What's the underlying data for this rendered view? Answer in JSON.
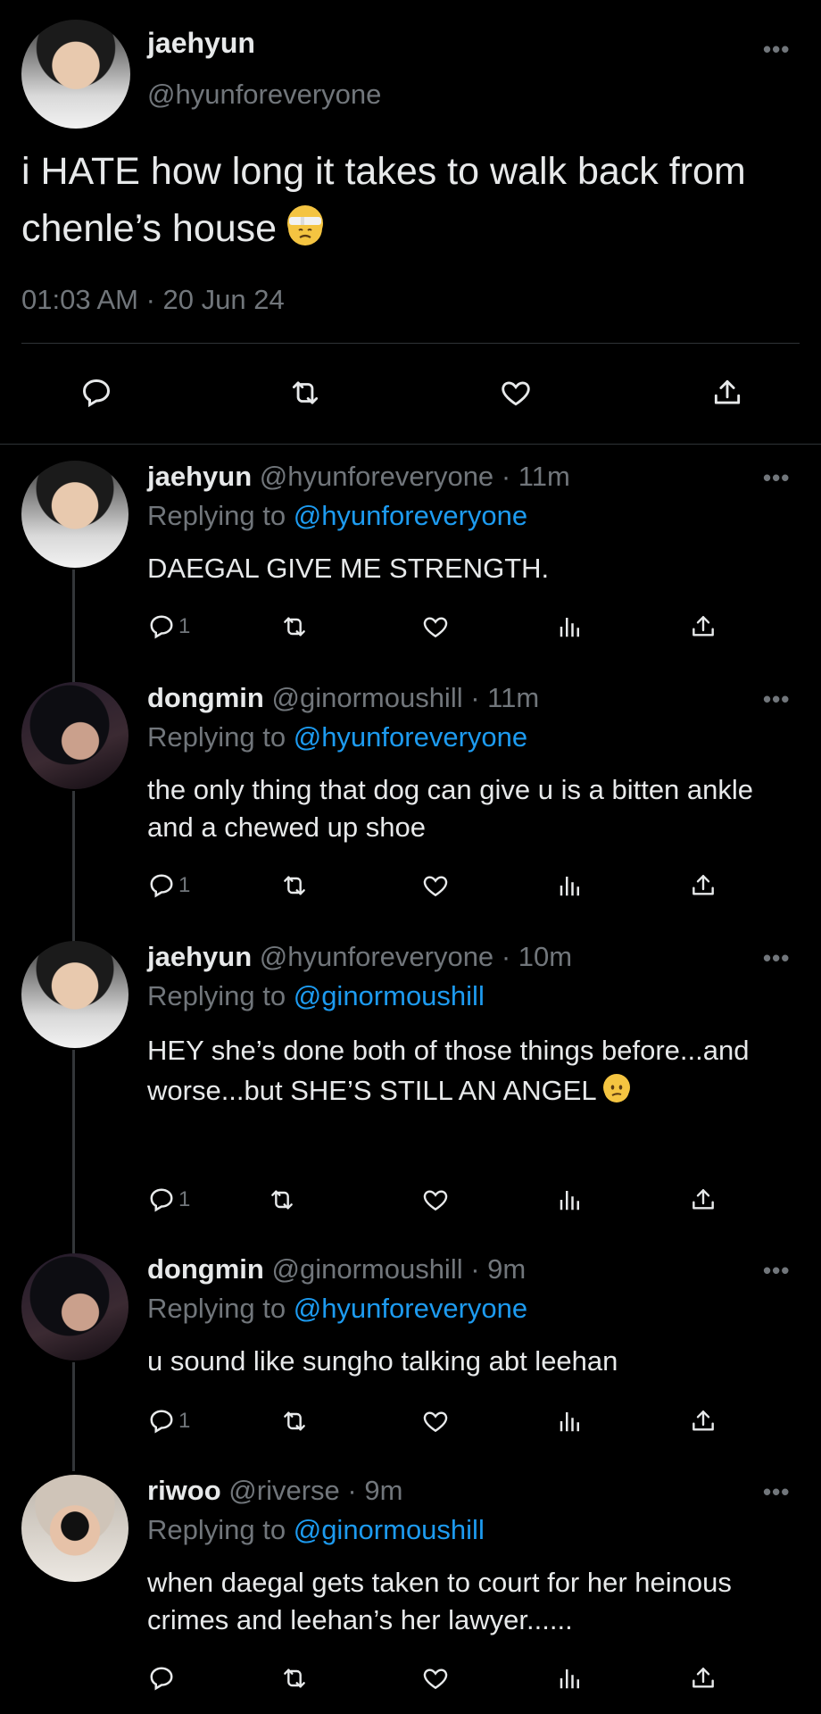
{
  "main_tweet": {
    "name": "jaehyun",
    "handle": "@hyunforeveryone",
    "text": "i HATE how long it takes to walk back from chenle’s house",
    "emoji": "face-with-head-bandage",
    "timestamp": "01:03 AM · 20 Jun 24"
  },
  "icons": {
    "more": "•••",
    "reply": "reply-icon",
    "retweet": "retweet-icon",
    "like": "heart-icon",
    "views": "views-icon",
    "share": "share-icon"
  },
  "colors": {
    "background": "#000000",
    "text": "#e7e9ea",
    "secondary": "#71767b",
    "link": "#1d9bf0",
    "divider": "#2f3336"
  },
  "replies": [
    {
      "name": "jaehyun",
      "handle": "@hyunforeveryone",
      "dot": "·",
      "time": "11m",
      "replying_prefix": "Replying to ",
      "replying_to": "@hyunforeveryone",
      "text": "DAEGAL GIVE ME STRENGTH.",
      "reply_count": "1"
    },
    {
      "name": "dongmin",
      "handle": "@ginormoushill",
      "dot": "·",
      "time": "11m",
      "replying_prefix": "Replying to ",
      "replying_to": "@hyunforeveryone",
      "text": "the only thing that dog can give u is a bitten ankle and a chewed up shoe",
      "reply_count": "1"
    },
    {
      "name": "jaehyun",
      "handle": "@hyunforeveryone",
      "dot": "·",
      "time": "10m",
      "replying_prefix": "Replying to ",
      "replying_to": "@ginormoushill",
      "text": "HEY she’s done both of those things before...and worse...but SHE’S STILL AN ANGEL",
      "emoji": "confused-face",
      "reply_count": "1"
    },
    {
      "name": "dongmin",
      "handle": "@ginormoushill",
      "dot": "·",
      "time": "9m",
      "replying_prefix": "Replying to ",
      "replying_to": "@hyunforeveryone",
      "text": "u sound like sungho talking abt leehan",
      "reply_count": "1"
    },
    {
      "name": "riwoo",
      "handle": "@riverse",
      "dot": "·",
      "time": "9m",
      "replying_prefix": "Replying to ",
      "replying_to": "@ginormoushill",
      "text": "when daegal gets taken to court for her heinous crimes and leehan’s her lawyer......",
      "reply_count": ""
    }
  ]
}
